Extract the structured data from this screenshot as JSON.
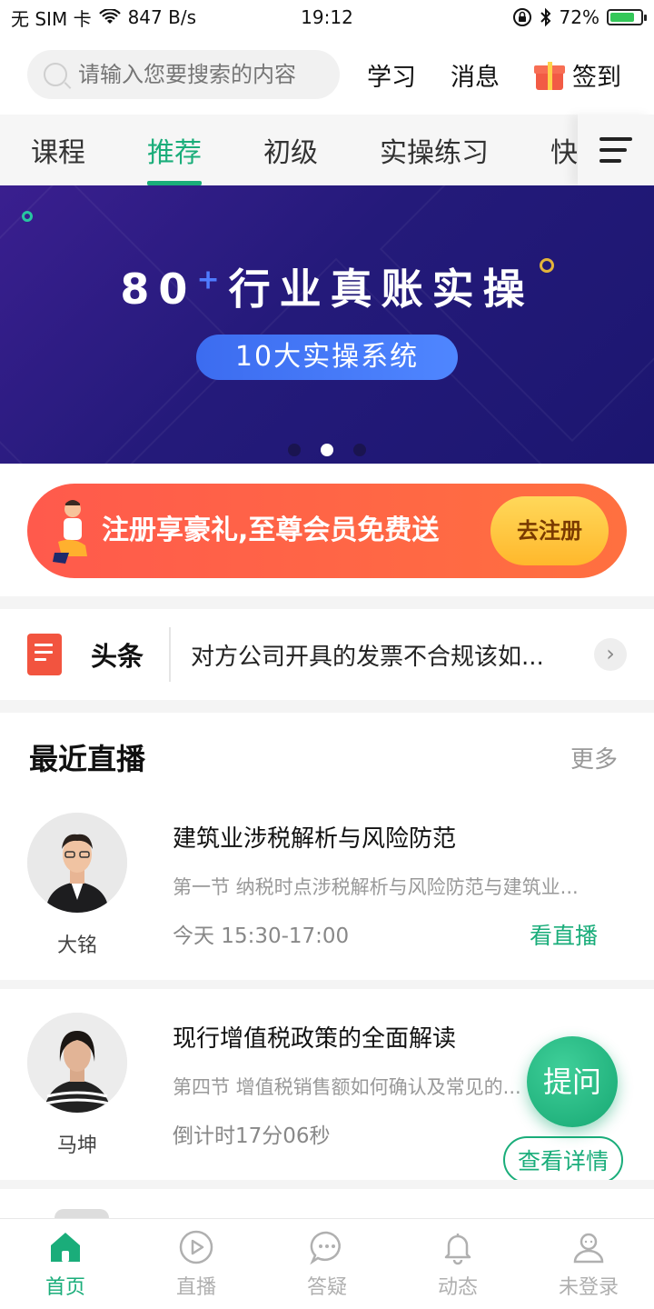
{
  "status_bar": {
    "carrier": "无 SIM 卡",
    "speed": "847 B/s",
    "time": "19:12",
    "battery": "72%"
  },
  "header": {
    "search_placeholder": "请输入您要搜索的内容",
    "links": [
      "学习",
      "消息"
    ],
    "checkin": "签到"
  },
  "tabs": {
    "items": [
      "课程",
      "推荐",
      "初级",
      "实操练习",
      "快"
    ],
    "active_index": 1
  },
  "banner": {
    "title_number": "80",
    "title_sup": "+",
    "title_text": "行业真账实操",
    "pill": "10大实操系统",
    "page_count": 3,
    "active_dot": 1
  },
  "promo": {
    "text": "注册享豪礼,至尊会员免费送",
    "button": "去注册"
  },
  "headline": {
    "label": "头条",
    "text": "对方公司开具的发票不合规该如..."
  },
  "live": {
    "heading": "最近直播",
    "more": "更多",
    "items": [
      {
        "name": "大铭",
        "title": "建筑业涉税解析与风险防范",
        "subtitle": "第一节 纳税时点涉税解析与风险防范与建筑业...",
        "time": "今天 15:30-17:00",
        "action": "看直播"
      },
      {
        "name": "马坤",
        "title": "现行增值税政策的全面解读",
        "subtitle": "第四节 增值税销售额如何确认及常见的...",
        "time": "倒计时17分06秒",
        "action": "查看详情"
      }
    ]
  },
  "fab": {
    "label": "提问"
  },
  "bottom_nav": {
    "items": [
      "首页",
      "直播",
      "答疑",
      "动态",
      "未登录"
    ],
    "active_index": 0
  },
  "colors": {
    "accent": "#1aad7a",
    "promo": "#ff5a4c",
    "banner": "#241a7a"
  }
}
